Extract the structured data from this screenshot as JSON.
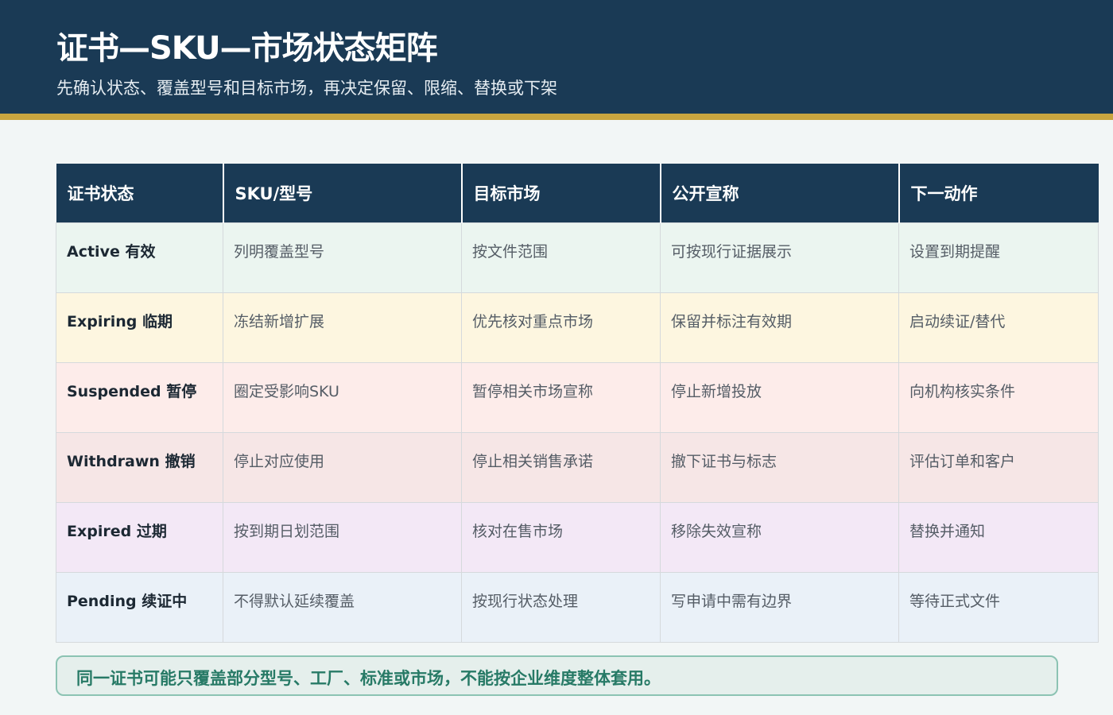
{
  "header": {
    "title": "证书—SKU—市场状态矩阵",
    "subtitle": "先确认状态、覆盖型号和目标市场，再决定保留、限缩、替换或下架"
  },
  "table": {
    "columns": [
      "证书状态",
      "SKU/型号",
      "目标市场",
      "公开宣称",
      "下一动作"
    ],
    "rows": [
      {
        "status": "Active 有效",
        "sku": "列明覆盖型号",
        "market": "按文件范围",
        "claim": "可按现行证据展示",
        "action": "设置到期提醒",
        "bg": "#ebf5f0"
      },
      {
        "status": "Expiring 临期",
        "sku": "冻结新增扩展",
        "market": "优先核对重点市场",
        "claim": "保留并标注有效期",
        "action": "启动续证/替代",
        "bg": "#fdf6e0"
      },
      {
        "status": "Suspended 暂停",
        "sku": "圈定受影响SKU",
        "market": "暂停相关市场宣称",
        "claim": "停止新增投放",
        "action": "向机构核实条件",
        "bg": "#fdecea"
      },
      {
        "status": "Withdrawn 撤销",
        "sku": "停止对应使用",
        "market": "停止相关销售承诺",
        "claim": "撤下证书与标志",
        "action": "评估订单和客户",
        "bg": "#f6e6e6"
      },
      {
        "status": "Expired 过期",
        "sku": "按到期日划范围",
        "market": "核对在售市场",
        "claim": "移除失效宣称",
        "action": "替换并通知",
        "bg": "#f3e8f6"
      },
      {
        "status": "Pending 续证中",
        "sku": "不得默认延续覆盖",
        "market": "按现行状态处理",
        "claim": "写申请中需有边界",
        "action": "等待正式文件",
        "bg": "#eaf1f8"
      }
    ]
  },
  "note": "同一证书可能只覆盖部分型号、工厂、标准或市场，不能按企业维度整体套用。",
  "colors": {
    "header_bg": "#1a3a55",
    "accent_stripe": "#c9a53f",
    "note_text": "#277a66",
    "note_border": "#8cc3b3"
  }
}
